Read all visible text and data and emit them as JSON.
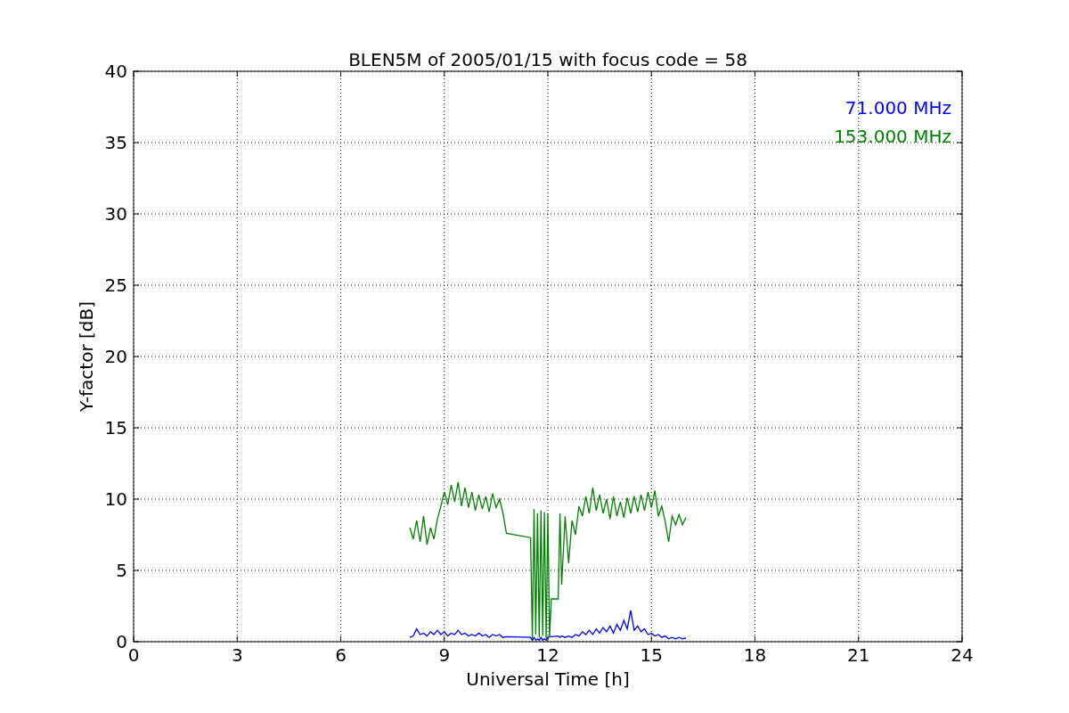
{
  "figure": {
    "chart_data": {
      "type": "line",
      "title": "BLEN5M of 2005/01/15 with focus code = 58",
      "xlabel": "Universal Time [h]",
      "ylabel": "Y-factor [dB]",
      "grid": true,
      "xlim": [
        0,
        24
      ],
      "ylim": [
        0,
        40
      ],
      "xticks": [
        0,
        3,
        6,
        9,
        12,
        15,
        18,
        21,
        24
      ],
      "yticks": [
        0,
        5,
        10,
        15,
        20,
        25,
        30,
        35,
        40
      ],
      "x": [
        8.0,
        8.1,
        8.2,
        8.3,
        8.4,
        8.5,
        8.6,
        8.7,
        8.8,
        8.9,
        9.0,
        9.1,
        9.2,
        9.3,
        9.4,
        9.5,
        9.6,
        9.7,
        9.8,
        9.9,
        10.0,
        10.1,
        10.2,
        10.3,
        10.4,
        10.5,
        10.6,
        10.7,
        10.8,
        11.5,
        11.55,
        11.6,
        11.65,
        11.7,
        11.75,
        11.8,
        11.85,
        11.9,
        11.95,
        12.0,
        12.05,
        12.1,
        12.3,
        12.35,
        12.4,
        12.5,
        12.6,
        12.7,
        12.8,
        12.9,
        13.0,
        13.1,
        13.2,
        13.3,
        13.4,
        13.5,
        13.6,
        13.7,
        13.8,
        13.9,
        14.0,
        14.1,
        14.2,
        14.3,
        14.4,
        14.5,
        14.6,
        14.7,
        14.8,
        14.9,
        15.0,
        15.1,
        15.2,
        15.3,
        15.4,
        15.5,
        15.6,
        15.7,
        15.8,
        15.9,
        16.0
      ],
      "series": [
        {
          "name": "71.000 MHz",
          "color": "#0000ff",
          "values": [
            0.3,
            0.4,
            0.9,
            0.5,
            0.6,
            0.4,
            0.7,
            0.5,
            0.8,
            0.5,
            0.7,
            0.4,
            0.6,
            0.5,
            0.8,
            0.5,
            0.6,
            0.4,
            0.5,
            0.4,
            0.6,
            0.4,
            0.5,
            0.3,
            0.5,
            0.4,
            0.5,
            0.3,
            0.35,
            0.3,
            0.1,
            0.3,
            0.1,
            0.2,
            0.1,
            0.3,
            0.1,
            0.2,
            0.1,
            0.3,
            0.35,
            0.35,
            0.4,
            0.3,
            0.4,
            0.3,
            0.4,
            0.3,
            0.5,
            0.4,
            0.7,
            0.5,
            0.8,
            0.5,
            0.9,
            0.6,
            1.0,
            0.7,
            1.1,
            0.6,
            1.2,
            0.8,
            1.5,
            0.9,
            2.2,
            0.8,
            1.1,
            0.7,
            0.9,
            0.5,
            0.6,
            0.4,
            0.5,
            0.3,
            0.4,
            0.2,
            0.3,
            0.2,
            0.3,
            0.2,
            0.25
          ]
        },
        {
          "name": "153.000 MHz",
          "color": "#008000",
          "values": [
            8.0,
            7.2,
            8.5,
            7.0,
            8.8,
            6.8,
            8.0,
            7.2,
            8.6,
            9.5,
            10.5,
            9.6,
            11.0,
            9.8,
            11.2,
            9.5,
            10.8,
            9.4,
            10.5,
            9.2,
            10.3,
            9.3,
            10.2,
            9.1,
            10.4,
            9.4,
            10.0,
            9.0,
            7.6,
            7.3,
            0.2,
            9.3,
            0.5,
            9.0,
            0.3,
            9.2,
            0.4,
            9.1,
            0.2,
            9.0,
            0.3,
            3.0,
            3.0,
            9.0,
            4.0,
            8.8,
            5.5,
            8.5,
            7.5,
            9.5,
            8.8,
            10.2,
            9.0,
            10.8,
            9.2,
            10.3,
            9.0,
            10.0,
            8.6,
            10.2,
            8.8,
            9.8,
            8.7,
            10.1,
            9.0,
            10.2,
            9.1,
            10.3,
            9.2,
            10.5,
            9.4,
            10.6,
            8.8,
            9.5,
            8.4,
            7.0,
            8.8,
            8.2,
            8.9,
            8.2,
            8.7
          ]
        }
      ]
    }
  }
}
